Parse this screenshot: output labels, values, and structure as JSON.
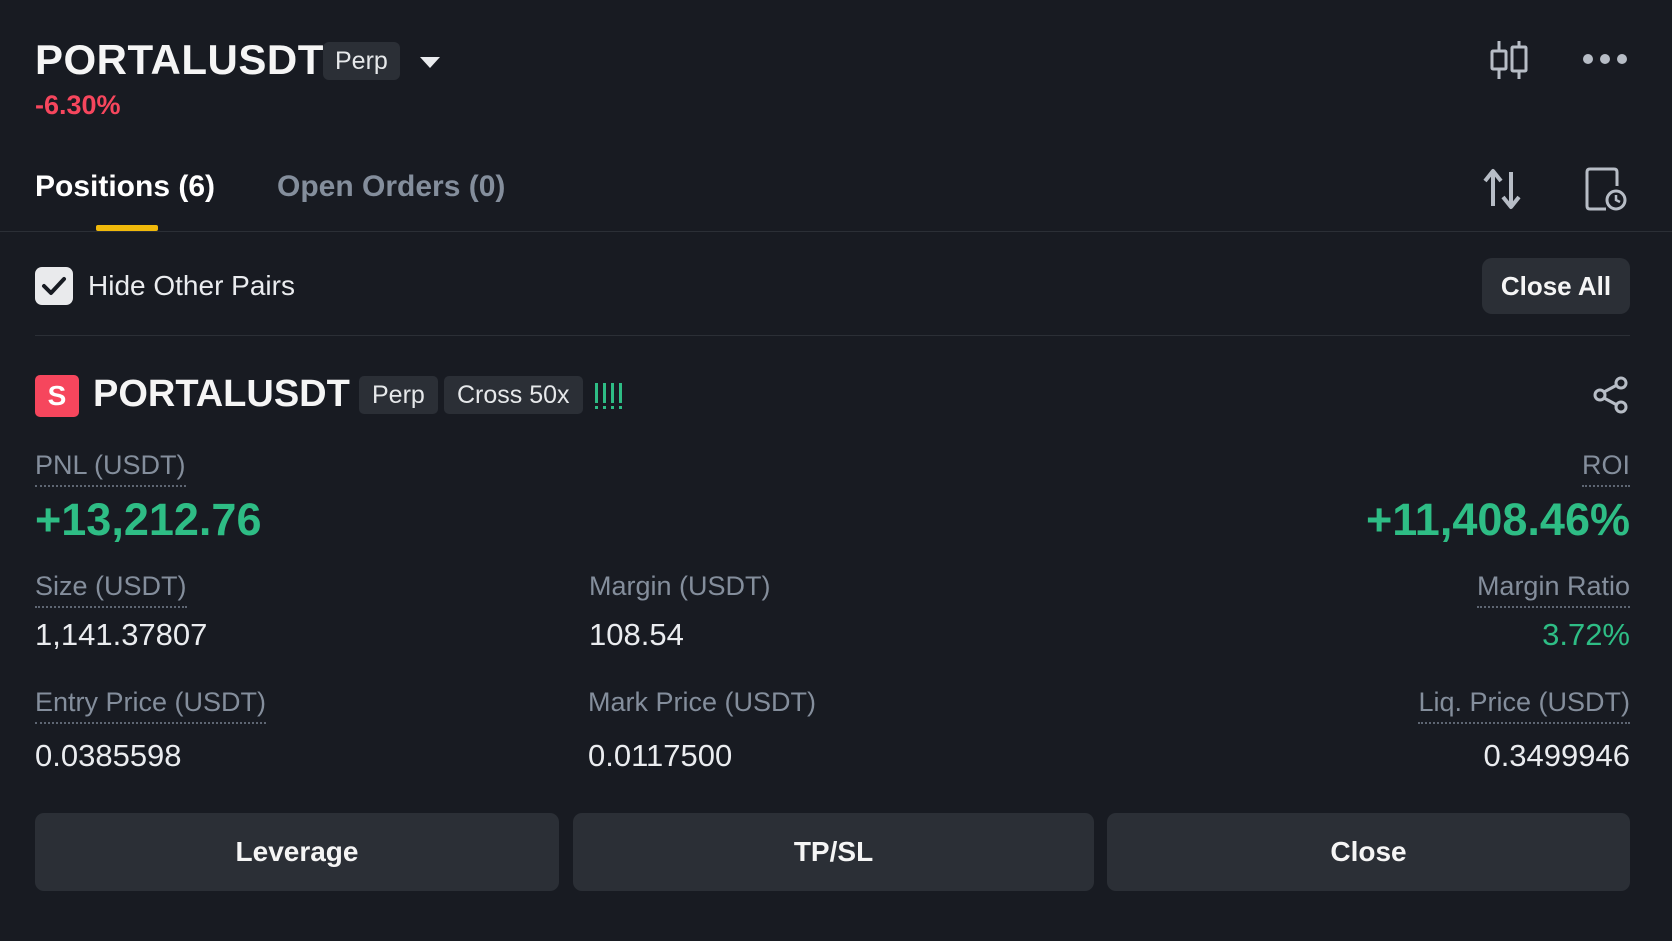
{
  "header": {
    "symbol": "PORTALUSDT",
    "contract_type": "Perp",
    "change_pct": "-6.30%",
    "icons": [
      "candlestick-chart-icon",
      "more-icon",
      "chevron-down-icon"
    ]
  },
  "tabs": [
    {
      "label": "Positions (6)",
      "active": true
    },
    {
      "label": "Open Orders (0)",
      "active": false
    }
  ],
  "toolbar_icons": [
    "sort-icon",
    "history-icon"
  ],
  "filter": {
    "hide_other_pairs_label": "Hide Other Pairs",
    "hide_other_pairs_checked": true,
    "close_all_label": "Close All"
  },
  "position": {
    "side": "S",
    "symbol": "PORTALUSDT",
    "contract_type": "Perp",
    "margin_mode": "Cross 50x",
    "signal_marker": "!!!!",
    "pnl_label": "PNL (USDT)",
    "pnl_value": "+13,212.76",
    "roi_label": "ROI",
    "roi_value": "+11,408.46%",
    "size_label": "Size (USDT)",
    "size_value": "1,141.37807",
    "margin_label": "Margin (USDT)",
    "margin_value": "108.54",
    "margin_ratio_label": "Margin Ratio",
    "margin_ratio_value": "3.72%",
    "entry_price_label": "Entry Price (USDT)",
    "entry_price_value": "0.0385598",
    "mark_price_label": "Mark Price (USDT)",
    "mark_price_value": "0.0117500",
    "liq_price_label": "Liq. Price (USDT)",
    "liq_price_value": "0.3499946"
  },
  "actions": {
    "leverage_label": "Leverage",
    "tpsl_label": "TP/SL",
    "close_label": "Close"
  },
  "colors": {
    "background": "#181b22",
    "positive": "#2ebd85",
    "negative": "#f6465d",
    "accent": "#f0b90b",
    "muted": "#848e9c"
  }
}
